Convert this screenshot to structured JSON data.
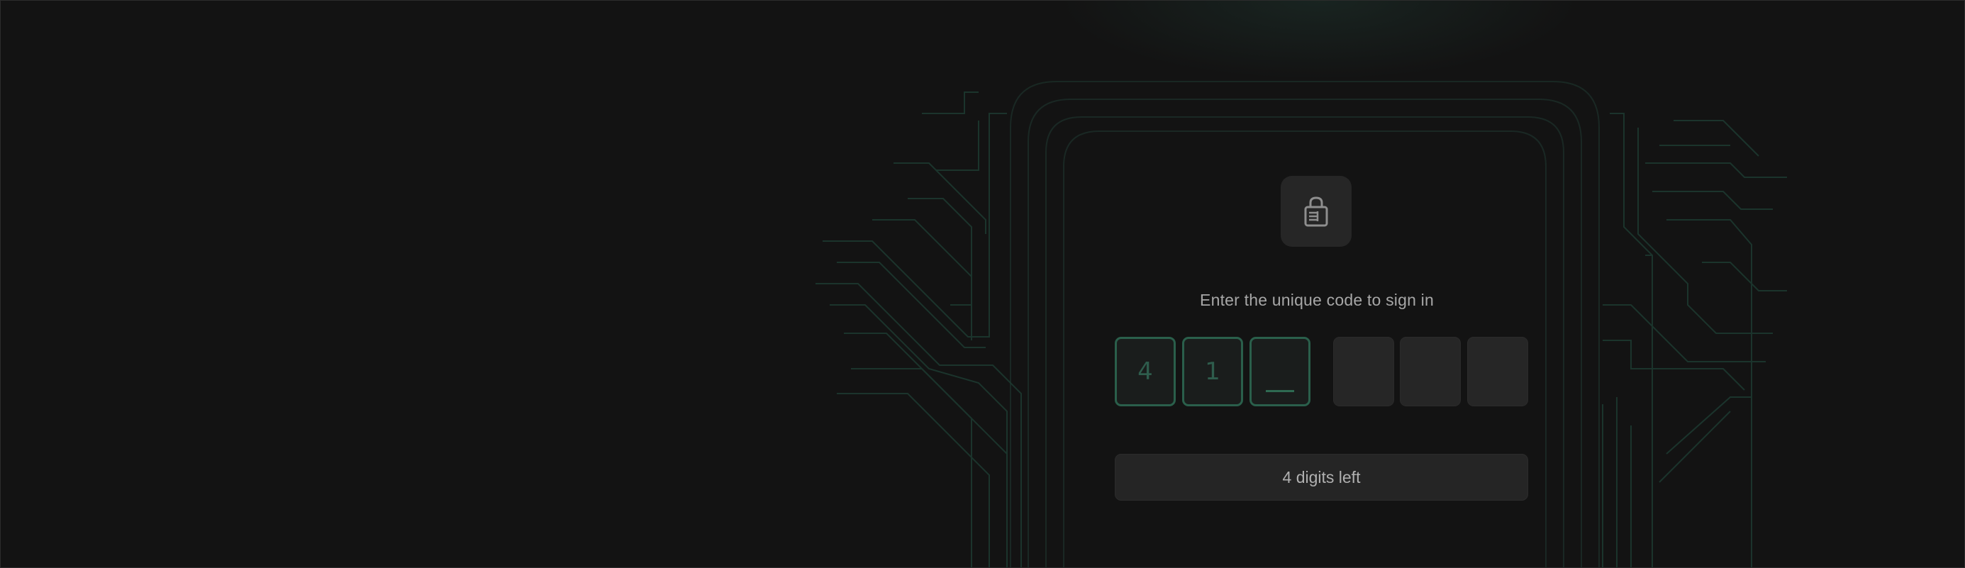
{
  "auth": {
    "prompt": "Enter the unique code to sign in",
    "code_digits": [
      "4",
      "1",
      "",
      "",
      "",
      ""
    ],
    "active_index": 2,
    "status": "4 digits left"
  },
  "icons": {
    "header": "lock-icon"
  },
  "colors": {
    "background": "#131313",
    "accent_green": "#2a5f4b",
    "circuit_line": "#1f3a32",
    "tile": "#262626",
    "text_muted": "#a7a7a7"
  }
}
